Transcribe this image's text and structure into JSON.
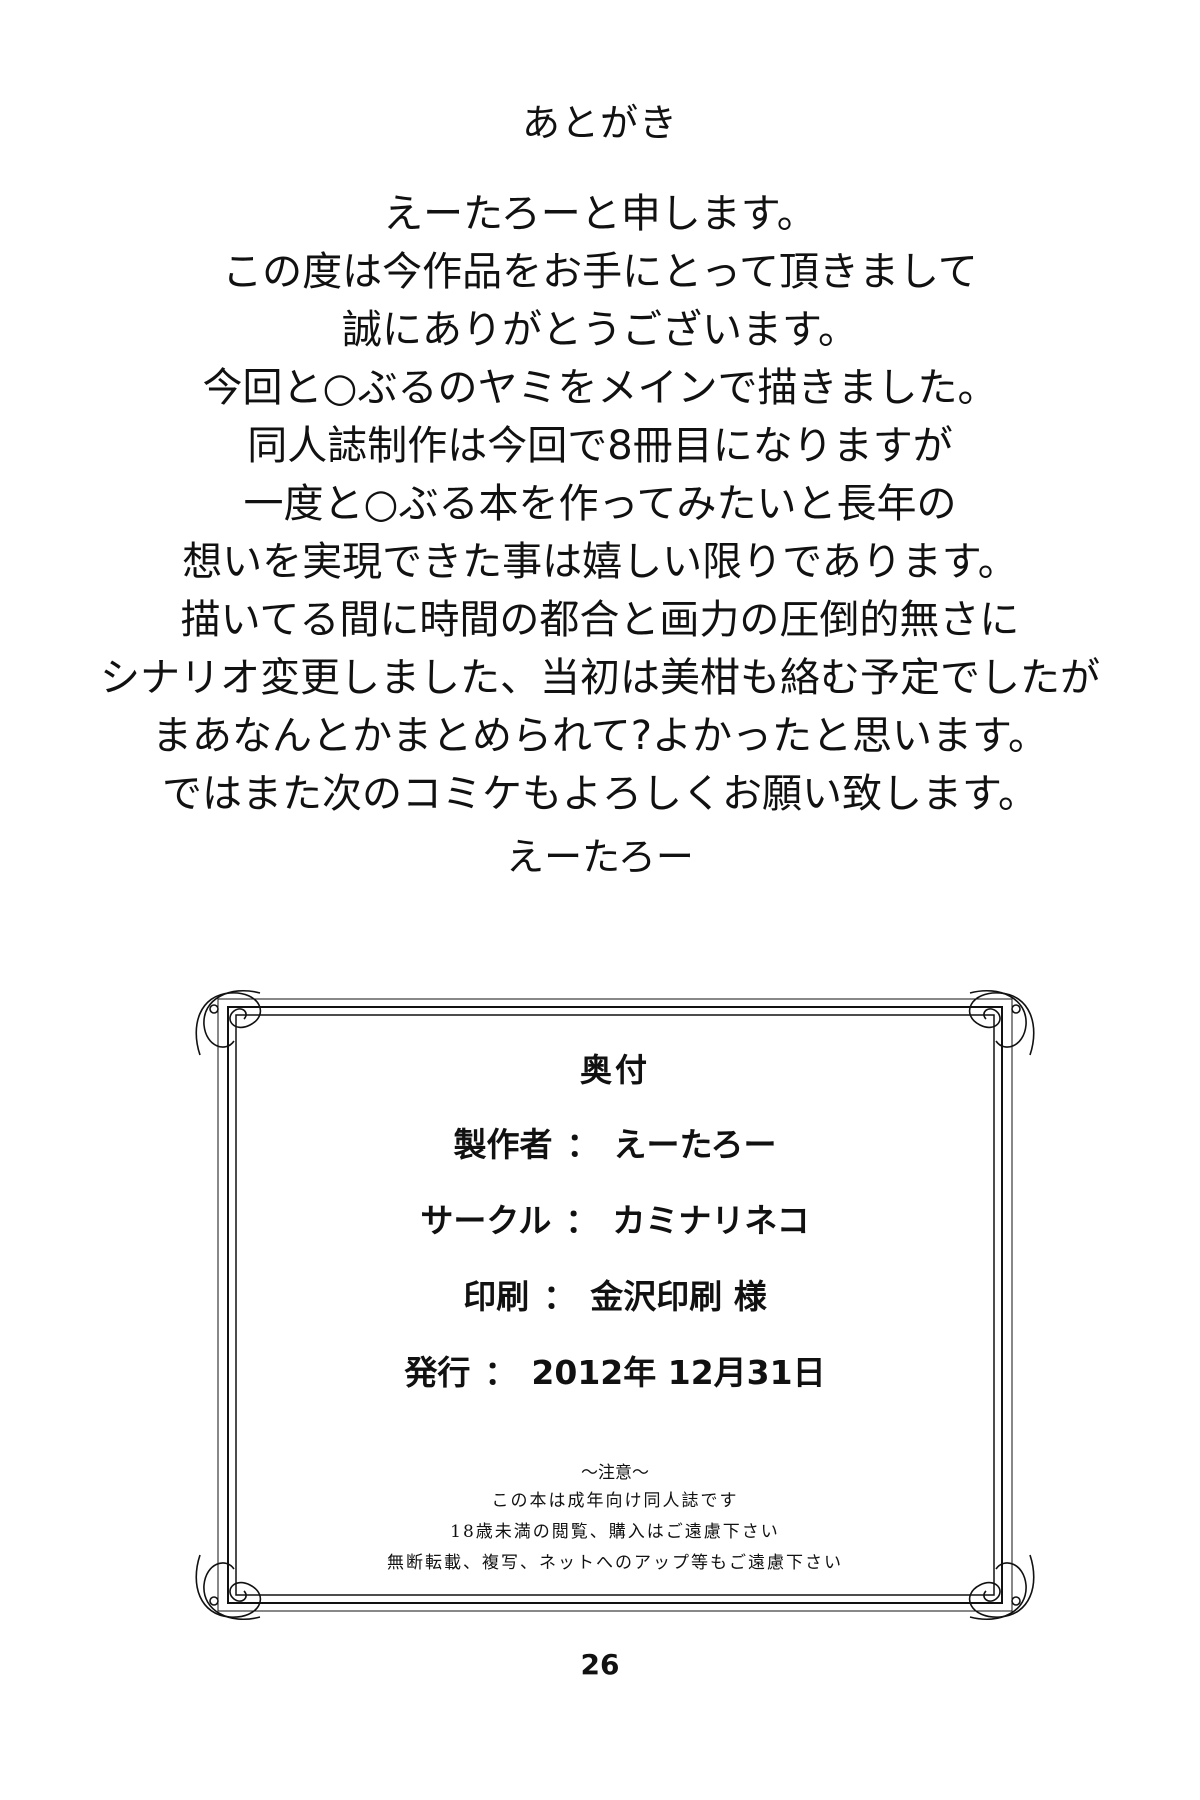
{
  "afterword": {
    "title": "あとがき",
    "lines": [
      "えーたろーと申します。",
      "この度は今作品をお手にとって頂きまして",
      "誠にありがとうございます。",
      "今回と○ぶるのヤミをメインで描きました。",
      "同人誌制作は今回で8冊目になりますが",
      "一度と○ぶる本を作ってみたいと長年の",
      "想いを実現できた事は嬉しい限りであります。",
      "描いてる間に時間の都合と画力の圧倒的無さに",
      "シナリオ変更しました、当初は美柑も絡む予定でしたが",
      "まあなんとかまとめられて?よかったと思います。",
      "ではまた次のコミケもよろしくお願い致します。"
    ],
    "signature": "えーたろー"
  },
  "colophon": {
    "title": "奥付",
    "rows": [
      {
        "label": "製作者",
        "separator": "：",
        "value": "えーたろー"
      },
      {
        "label": "サークル",
        "separator": "：",
        "value": "カミナリネコ"
      },
      {
        "label": "印刷",
        "separator": "：",
        "value": "金沢印刷 様"
      },
      {
        "label": "発行",
        "separator": "：",
        "value": "2012年 12月31日"
      }
    ],
    "notice": {
      "title": "～注意～",
      "lines": [
        "この本は成年向け同人誌です",
        "18歳未満の閲覧、購入はご遠慮下さい",
        "無断転載、複写、ネットへのアップ等もご遠慮下さい"
      ]
    }
  },
  "page_number": "26"
}
